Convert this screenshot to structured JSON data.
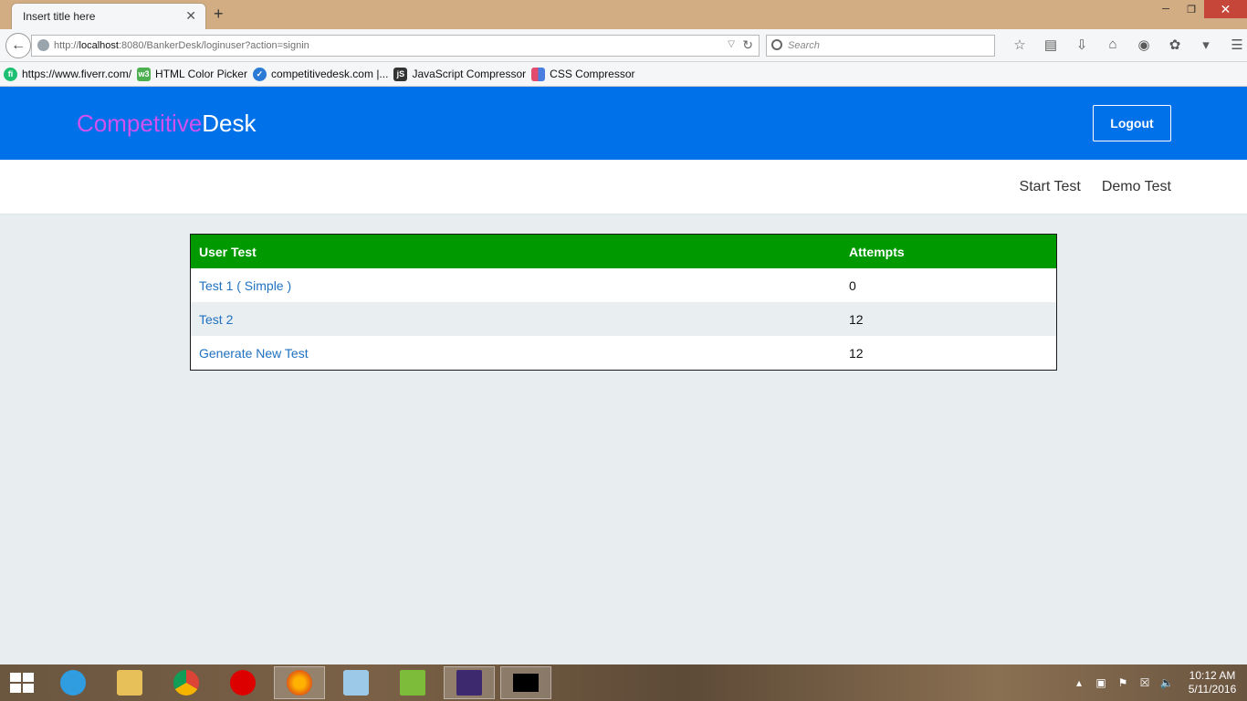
{
  "browser": {
    "tab_title": "Insert title here",
    "tab_close": "✕",
    "new_tab": "+",
    "url_prefix": "http://",
    "url_host": "localhost",
    "url_rest": ":8080/BankerDesk/loginuser?action=signin",
    "search_placeholder": "Search",
    "bookmarks": [
      {
        "label": "https://www.fiverr.com/",
        "icon": "fiverr-icon",
        "color": "#1dbf73",
        "glyph": "fi"
      },
      {
        "label": "HTML Color Picker",
        "icon": "w3-icon",
        "color": "#4caf50",
        "glyph": "w3"
      },
      {
        "label": "competitivedesk.com |...",
        "icon": "check-badge-icon",
        "color": "#2b7bd6",
        "glyph": "✓"
      },
      {
        "label": "JavaScript Compressor",
        "icon": "js-icon",
        "color": "#333333",
        "glyph": "jS"
      },
      {
        "label": "CSS Compressor",
        "icon": "css-icon",
        "color": "#e24b6c",
        "glyph": ""
      }
    ]
  },
  "site": {
    "logo_part1": "Competitive",
    "logo_part2": "Desk",
    "logout_label": "Logout",
    "nav": [
      "Start Test",
      "Demo Test"
    ]
  },
  "table": {
    "headers": [
      "User Test",
      "Attempts"
    ],
    "rows": [
      {
        "test": "Test 1 ( Simple )",
        "attempts": "0"
      },
      {
        "test": "Test 2",
        "attempts": "12"
      },
      {
        "test": "Generate New Test",
        "attempts": "12"
      }
    ]
  },
  "taskbar": {
    "time": "10:12 AM",
    "date": "5/11/2016"
  },
  "colors": {
    "header_bg": "#0071e8",
    "logo_accent": "#cf52f0",
    "table_header": "#009a00",
    "link": "#1f71c0"
  }
}
